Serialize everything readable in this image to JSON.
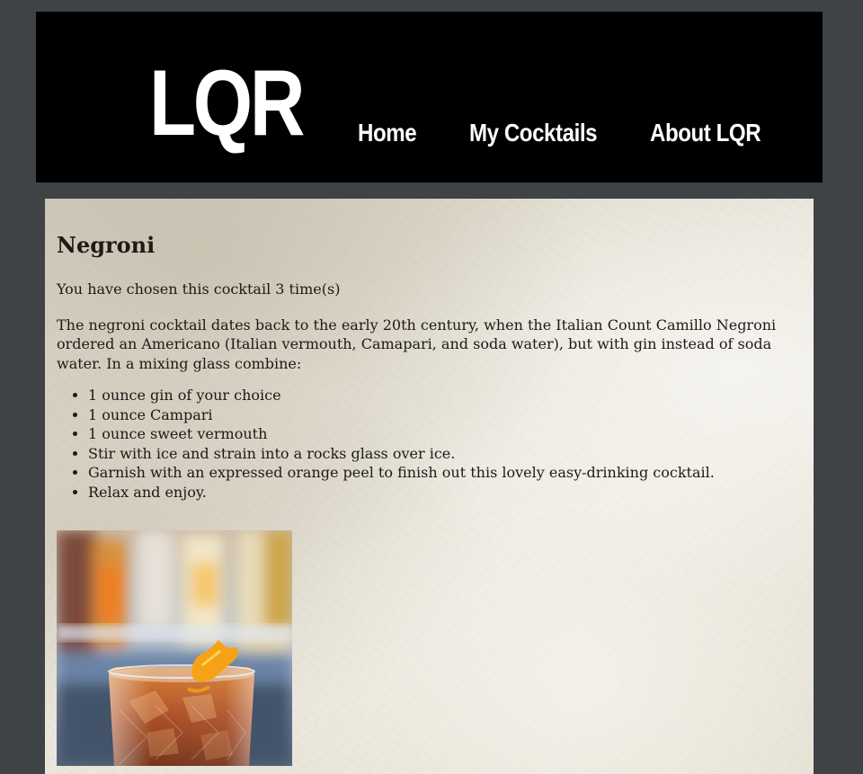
{
  "header": {
    "logo_text": "LQR",
    "nav": [
      {
        "label": "Home"
      },
      {
        "label": "My Cocktails"
      },
      {
        "label": "About LQR"
      }
    ]
  },
  "main": {
    "title": "Negroni",
    "count_text": "You have chosen this cocktail 3 time(s)",
    "description": "The negroni cocktail dates back to the early 20th century, when the Italian Count Camillo Negroni ordered an Americano (Italian vermouth, Camapari, and soda water), but with gin instead of soda water. In a mixing glass combine:",
    "steps": [
      "1 ounce gin of your choice",
      "1 ounce Campari",
      "1 ounce sweet vermouth",
      "Stir with ice and strain into a rocks glass over ice.",
      "Garnish with an expressed orange peel to finish out this lovely easy-drinking cocktail.",
      "Relax and enjoy."
    ]
  },
  "colors": {
    "page_bg": "#3f4345",
    "header_bg": "#000000",
    "header_text": "#ffffff",
    "body_text": "#1d1a17"
  }
}
